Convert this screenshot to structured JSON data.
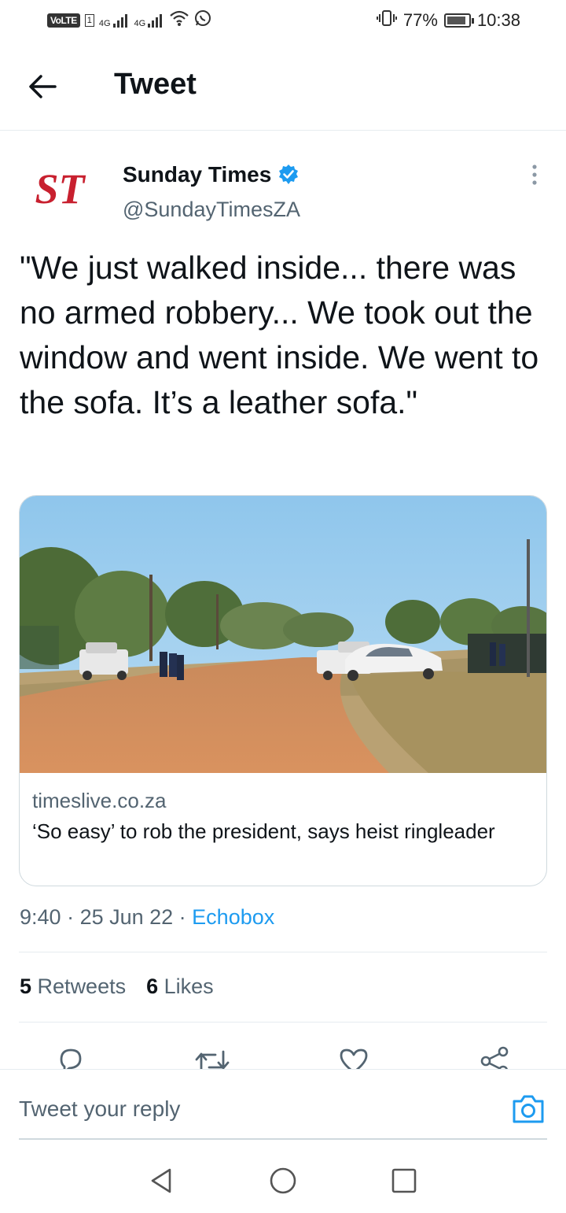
{
  "status_bar": {
    "network_badge": "VoLTE",
    "sim_slot": "1",
    "signal_1": "4G",
    "signal_2": "4G",
    "battery": "77%",
    "time": "10:38"
  },
  "header": {
    "title": "Tweet"
  },
  "author": {
    "avatar_text": "ST",
    "name": "Sunday Times",
    "handle": "@SundayTimesZA",
    "verified": true
  },
  "tweet": {
    "text": "\"We just walked inside... there was no armed robbery... We took out the window and went inside. We went to the sofa. It’s a leather sofa.\""
  },
  "link_card": {
    "domain": "timeslive.co.za",
    "title": "‘So easy’ to rob the president, says heist ringleader"
  },
  "meta": {
    "time": "9:40",
    "sep1": " · ",
    "date": "25 Jun 22",
    "sep2": " · ",
    "source": "Echobox"
  },
  "stats": {
    "retweets_count": "5",
    "retweets_label": "Retweets",
    "likes_count": "6",
    "likes_label": "Likes"
  },
  "reply": {
    "placeholder": "Tweet your reply"
  },
  "colors": {
    "accent": "#1d9bf0",
    "secondary_text": "#536471",
    "brand_red": "#c8202f"
  },
  "icons": {
    "back": "arrow-left-icon",
    "verified": "verified-badge-icon",
    "more": "more-vertical-icon",
    "reply": "reply-icon",
    "retweet": "retweet-icon",
    "like": "heart-icon",
    "share": "share-icon",
    "camera": "camera-icon"
  }
}
